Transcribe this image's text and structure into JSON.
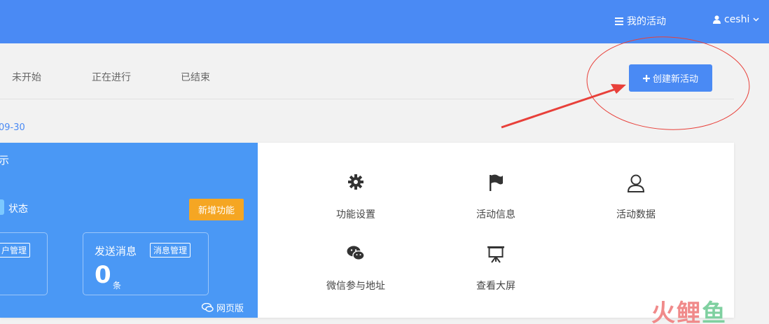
{
  "header": {
    "my_activity_label": "我的活动",
    "user_name": "ceshi"
  },
  "tabs": [
    {
      "label": "未开始"
    },
    {
      "label": "正在进行"
    },
    {
      "label": "已结束"
    }
  ],
  "create_button_label": "创建新活动",
  "activity_date": "09-30",
  "panel": {
    "title_fragment": "示",
    "status_label": "状态",
    "new_feature_label": "新增功能",
    "user_manage_button": "户管理",
    "send_message_title": "发送消息",
    "message_manage_button": "消息管理",
    "message_count": "0",
    "message_unit": "条",
    "web_version_label": "网页版"
  },
  "features": [
    {
      "label": "功能设置",
      "icon": "gear-icon"
    },
    {
      "label": "活动信息",
      "icon": "flag-icon"
    },
    {
      "label": "活动数据",
      "icon": "user-icon"
    },
    {
      "label": "微信参与地址",
      "icon": "wechat-icon"
    },
    {
      "label": "查看大屏",
      "icon": "presentation-icon"
    }
  ],
  "watermark": {
    "part1": "火",
    "part2": "鲤",
    "part3": "鱼"
  },
  "colors": {
    "primary": "#4a8af4",
    "panel": "#4a98f5",
    "warning": "#f5a623",
    "annotation": "#e8403a"
  }
}
